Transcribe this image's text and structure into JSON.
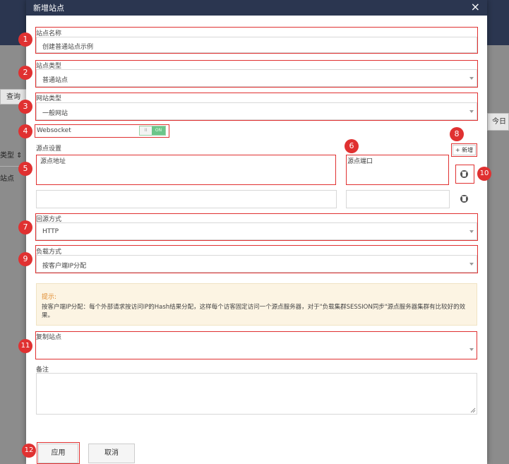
{
  "background": {
    "search_label": "查询",
    "col_type_label": "类型 ⇕",
    "cell_site_label": "站点",
    "today_label": "今日"
  },
  "modal": {
    "title": "新增站点",
    "close_glyph": "×"
  },
  "form": {
    "site_name": {
      "label": "站点名称",
      "value": "创建普通站点示例"
    },
    "site_type": {
      "label": "站点类型",
      "value": "普通站点"
    },
    "web_type": {
      "label": "网站类型",
      "value": "一般网站"
    },
    "websocket": {
      "label": "Websocket",
      "toggle_off": "II",
      "toggle_on": "ON",
      "enabled": true
    },
    "origin_settings": {
      "label": "源点设置",
      "add_button": "+ 新增",
      "address_label": "源点地址",
      "port_label": "源点端口",
      "rows": [
        {
          "address": "",
          "port": ""
        },
        {
          "address": "",
          "port": ""
        }
      ]
    },
    "back_to_origin": {
      "label": "回源方式",
      "value": "HTTP"
    },
    "load_balance": {
      "label": "负载方式",
      "value": "按客户端IP分配"
    },
    "hint": {
      "title": "提示:",
      "text": "按客户端IP分配：每个外部请求按访问IP的Hash结果分配，这样每个访客固定访问一个源点服务器，对于\"负载集群SESSION同步\"源点服务器集群有比较好的效果。"
    },
    "copy_site": {
      "label": "复制站点",
      "value": ""
    },
    "remark": {
      "label": "备注",
      "value": ""
    }
  },
  "buttons": {
    "apply": "应用",
    "cancel": "取消"
  },
  "badges": [
    "1",
    "2",
    "3",
    "4",
    "5",
    "6",
    "7",
    "8",
    "9",
    "10",
    "11",
    "12"
  ],
  "colors": {
    "header_bg": "#2b3650",
    "annotation_red": "#e03131",
    "toggle_on_green": "#6cc58a",
    "hint_bg": "#fcf4e3"
  }
}
